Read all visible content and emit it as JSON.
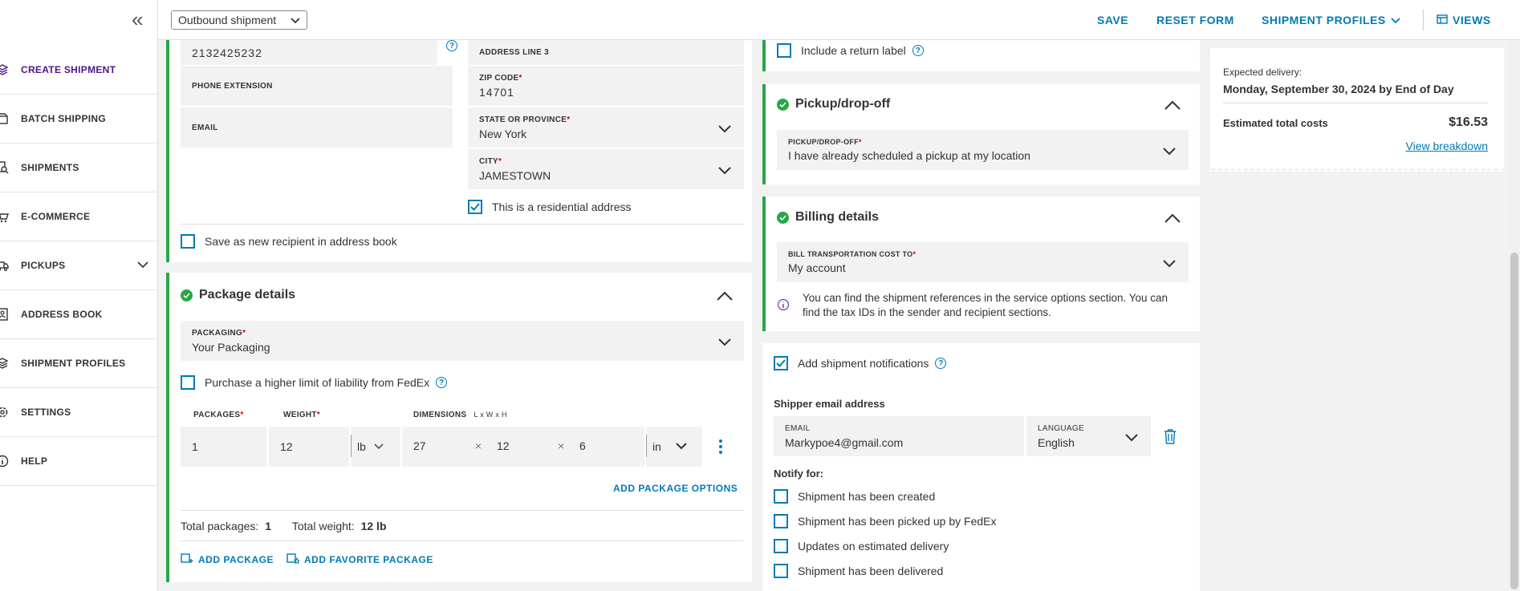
{
  "sidebar": {
    "items": [
      {
        "label": "CREATE SHIPMENT",
        "icon": "layers-icon"
      },
      {
        "label": "BATCH SHIPPING",
        "icon": "boxes-icon"
      },
      {
        "label": "SHIPMENTS",
        "icon": "search-doc-icon"
      },
      {
        "label": "E-COMMERCE",
        "icon": "cart-icon"
      },
      {
        "label": "PICKUPS",
        "icon": "truck-icon"
      },
      {
        "label": "ADDRESS BOOK",
        "icon": "contacts-icon"
      },
      {
        "label": "SHIPMENT PROFILES",
        "icon": "stack-icon"
      },
      {
        "label": "SETTINGS",
        "icon": "gear-icon"
      },
      {
        "label": "HELP",
        "icon": "info-icon"
      }
    ]
  },
  "topbar": {
    "shipment_type": "Outbound shipment",
    "save": "SAVE",
    "reset": "RESET FORM",
    "profiles": "SHIPMENT PROFILES",
    "views": "VIEWS"
  },
  "recipient": {
    "phone_value": "2132425232",
    "phone_extension_label": "PHONE EXTENSION",
    "email_label": "EMAIL",
    "address3_label": "ADDRESS LINE 3",
    "zip_label": "ZIP CODE",
    "zip_value": "14701",
    "state_label": "STATE OR PROVINCE",
    "state_value": "New York",
    "city_label": "CITY",
    "city_value": "JAMESTOWN",
    "residential_label": "This is a residential address",
    "save_recipient_label": "Save as new recipient in address book"
  },
  "package": {
    "title": "Package details",
    "packaging_label": "PACKAGING",
    "packaging_value": "Your Packaging",
    "liability_label": "Purchase a higher limit of liability from FedEx",
    "col_packages": "PACKAGES",
    "col_weight": "WEIGHT",
    "col_dimensions": "DIMENSIONS",
    "dimensions_hint": "L x W x H",
    "packages_value": "1",
    "weight_value": "12",
    "weight_unit": "lb",
    "dim_l": "27",
    "dim_w": "12",
    "dim_h": "6",
    "dim_unit": "in",
    "times": "×",
    "add_options": "ADD PACKAGE OPTIONS",
    "total_packages_label": "Total packages:",
    "total_packages_value": "1",
    "total_weight_label": "Total weight:",
    "total_weight_value": "12 lb",
    "add_package": "ADD PACKAGE",
    "add_favorite": "ADD FAVORITE PACKAGE"
  },
  "return_label": {
    "label": "Include a return label"
  },
  "pickup": {
    "title": "Pickup/drop-off",
    "field_label": "PICKUP/DROP-OFF",
    "field_value": "I have already scheduled a pickup at my location"
  },
  "billing": {
    "title": "Billing details",
    "field_label": "BILL TRANSPORTATION COST TO",
    "field_value": "My account",
    "info_text": "You can find the shipment references in the service options section. You can find the tax IDs in the sender and recipient sections."
  },
  "notifications": {
    "add_label": "Add shipment notifications",
    "shipper_email_title": "Shipper email address",
    "email_label": "EMAIL",
    "email_value": "Markypoe4@gmail.com",
    "language_label": "LANGUAGE",
    "language_value": "English",
    "notify_for": "Notify for:",
    "options": [
      "Shipment has been created",
      "Shipment has been picked up by FedEx",
      "Updates on estimated delivery",
      "Shipment has been delivered"
    ]
  },
  "summary": {
    "expected_label": "Expected delivery:",
    "expected_value": "Monday, September 30, 2024 by End of Day",
    "costs_label": "Estimated total costs",
    "costs_value": "$16.53",
    "breakdown_link": "View breakdown"
  },
  "colors": {
    "accent": "#007ab7",
    "brand": "#4d148c",
    "success": "#28a745",
    "required": "#dd0000"
  }
}
